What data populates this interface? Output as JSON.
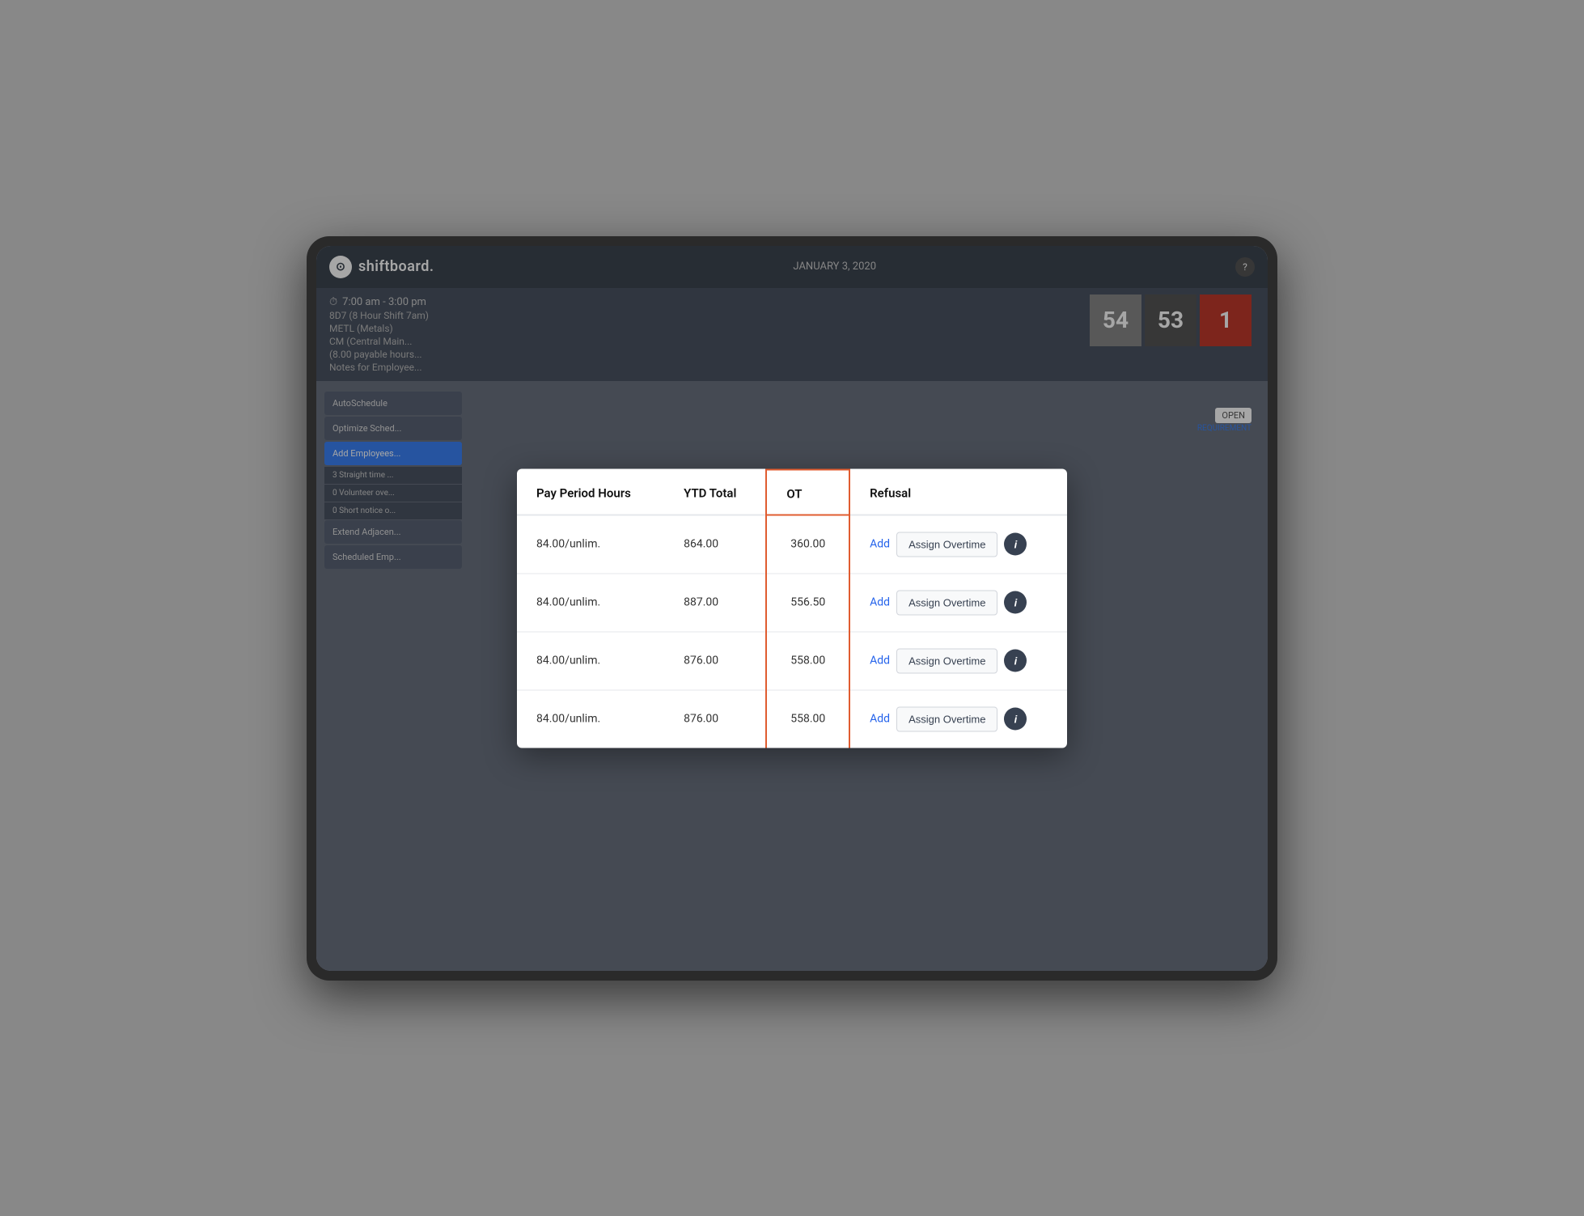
{
  "app": {
    "logo_text": "shiftboard.",
    "date": "JANUARY 3, 2020",
    "help_label": "?"
  },
  "shift": {
    "time": "7:00 am - 3:00 pm",
    "name": "8D7 (8 Hour Shift 7am)",
    "department": "METL (Metals)",
    "location": "CM (Central Main...",
    "hours_note": "(8.00 payable hours...",
    "notes_label": "Notes for Employee..."
  },
  "badges": [
    {
      "value": "54",
      "style": "gray"
    },
    {
      "value": "53",
      "style": "dark"
    },
    {
      "value": "1",
      "style": "red"
    }
  ],
  "sidebar": {
    "items": [
      {
        "label": "AutoSchedule",
        "active": false
      },
      {
        "label": "Optimize Sched...",
        "active": false
      },
      {
        "label": "Add Employees...",
        "active": true
      },
      {
        "label": "3 Straight time ...",
        "active": false
      },
      {
        "label": "0 Volunteer ove...",
        "active": false
      },
      {
        "label": "0 Short notice o...",
        "active": false
      },
      {
        "label": "Extend Adjacen...",
        "active": false
      },
      {
        "label": "Scheduled Emp...",
        "active": false
      }
    ]
  },
  "modal": {
    "columns": {
      "pay_period_hours": "Pay Period Hours",
      "ytd_total": "YTD Total",
      "ot": "OT",
      "refusal": "Refusal"
    },
    "rows": [
      {
        "pay_period_hours": "84.00/unlim.",
        "ytd_total": "864.00",
        "ot": "360.00",
        "add_label": "Add",
        "assign_label": "Assign Overtime",
        "info_label": "i"
      },
      {
        "pay_period_hours": "84.00/unlim.",
        "ytd_total": "887.00",
        "ot": "556.50",
        "add_label": "Add",
        "assign_label": "Assign Overtime",
        "info_label": "i"
      },
      {
        "pay_period_hours": "84.00/unlim.",
        "ytd_total": "876.00",
        "ot": "558.00",
        "add_label": "Add",
        "assign_label": "Assign Overtime",
        "info_label": "i"
      },
      {
        "pay_period_hours": "84.00/unlim.",
        "ytd_total": "876.00",
        "ot": "558.00",
        "add_label": "Add",
        "assign_label": "Assign Overtime",
        "info_label": "i"
      }
    ]
  },
  "status": {
    "open_label": "OPEN",
    "requirement_label": "REQUIREMENT"
  }
}
